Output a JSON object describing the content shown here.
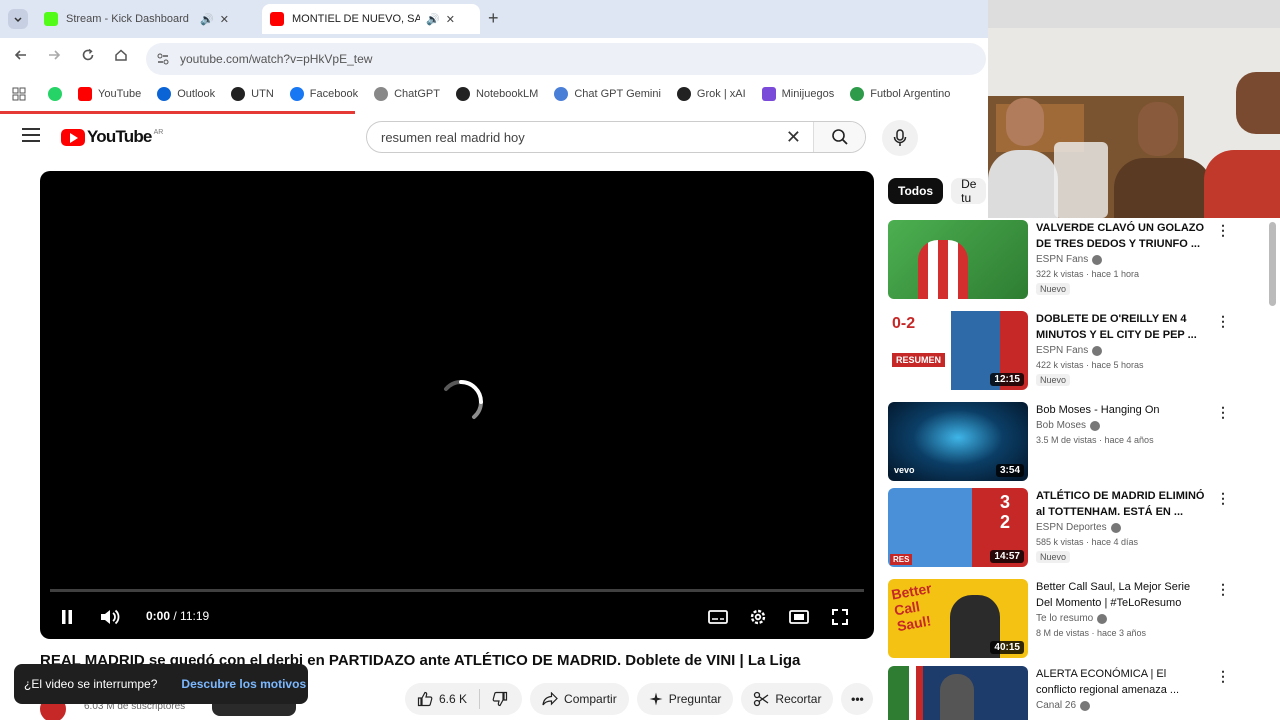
{
  "browser": {
    "tabs": [
      {
        "title": "Stream - Kick Dashboard",
        "active": false,
        "favicon_color": "#53fc18"
      },
      {
        "title": "MONTIEL DE NUEVO, SALI…",
        "active": true,
        "favicon_color": "#ff0000"
      }
    ],
    "url": "youtube.com/watch?v=pHkVpE_tew",
    "bookmarks": [
      {
        "label": "YouTube",
        "color": "#ff0000"
      },
      {
        "label": "Outlook",
        "color": "#0a64d6"
      },
      {
        "label": "UTN",
        "color": "#222222"
      },
      {
        "label": "Facebook",
        "color": "#1877f2"
      },
      {
        "label": "ChatGPT",
        "color": "#777777"
      },
      {
        "label": "NotebookLM",
        "color": "#222222"
      },
      {
        "label": "Chat GPT Gemini",
        "color": "#4a7fd8"
      },
      {
        "label": "Grok | xAI",
        "color": "#222222"
      },
      {
        "label": "Minijuegos",
        "color": "#7a4ad8"
      },
      {
        "label": "Futbol Argentino",
        "color": "#2e9b4a"
      }
    ]
  },
  "youtube": {
    "logo_text": "YouTube",
    "country_code": "AR",
    "search_query": "resumen real madrid hoy",
    "player": {
      "current_time": "0:00",
      "duration": "11:19",
      "progress": 0.0
    },
    "video_title": "REAL MADRID se quedó con el derbi en PARTIDAZO ante ATLÉTICO DE MADRID. Doblete de VINI | La Liga",
    "subscribers": "6.03 M de suscriptores",
    "actions": {
      "likes": "6.6 K",
      "share": "Compartir",
      "ask": "Preguntar",
      "clip": "Recortar"
    },
    "toast": {
      "text": "¿El video se interrumpe?",
      "link": "Descubre los motivos"
    },
    "chips": [
      "Todos",
      "De tu"
    ],
    "recommendations": [
      {
        "title": "VALVERDE CLAVÓ UN GOLAZO DE TRES DEDOS Y TRIUNFO ...",
        "channel": "ESPN Fans",
        "meta": "322 k vistas · hace 1 hora",
        "badge": "Nuevo",
        "duration": "",
        "thumb_color": "#3f9a3a"
      },
      {
        "title": "DOBLETE DE O'REILLY EN 4 MINUTOS Y EL CITY DE PEP ...",
        "channel": "ESPN Fans",
        "meta": "422 k vistas · hace 5 horas",
        "badge": "Nuevo",
        "duration": "12:15",
        "thumb_color": "#2f6aa8"
      },
      {
        "title": "Bob Moses - Hanging On",
        "channel": "Bob Moses",
        "meta": "3.5 M de vistas · hace 4 años",
        "badge": "",
        "duration": "3:54",
        "thumb_color": "#0b3e66"
      },
      {
        "title": "ATLÉTICO DE MADRID ELIMINÓ al TOTTENHAM. ESTÁ EN ...",
        "channel": "ESPN Deportes",
        "meta": "585 k vistas · hace 4 días",
        "badge": "Nuevo",
        "duration": "14:57",
        "thumb_color": "#c62828"
      },
      {
        "title": "Better Call Saul, La Mejor Serie Del Momento | #TeLoResumo",
        "channel": "Te lo resumo",
        "meta": "8 M de vistas · hace 3 años",
        "badge": "",
        "duration": "40:15",
        "thumb_color": "#f3c212"
      },
      {
        "title": "ALERTA ECONÓMICA | El conflicto regional amenaza ...",
        "channel": "Canal 26",
        "meta": "",
        "badge": "",
        "duration": "",
        "thumb_color": "#1d3b6b"
      }
    ]
  }
}
